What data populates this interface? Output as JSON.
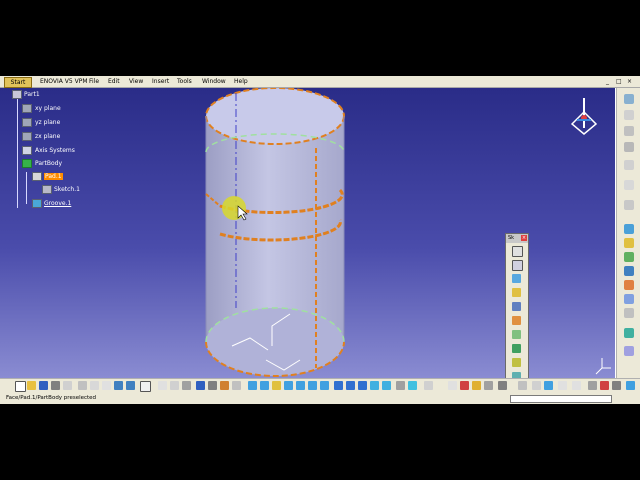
{
  "menu": {
    "start": "Start",
    "enovia": "ENOVIA V5 VPM",
    "file": "File",
    "edit": "Edit",
    "view": "View",
    "insert": "Insert",
    "tools": "Tools",
    "window": "Window",
    "help": "Help"
  },
  "tree": {
    "root": "Part1",
    "xy": "xy plane",
    "yz": "yz plane",
    "zx": "zx plane",
    "axis": "Axis Systems",
    "body": "PartBody",
    "pad": "Pad.1",
    "sketch": "Sketch.1",
    "groove": "Groove.1"
  },
  "sketch_toolbar": {
    "title": "Sk"
  },
  "status": {
    "text": "Face/Pad.1/PartBody preselected"
  },
  "colors": {
    "viewport_top": "#2a2c88",
    "viewport_bottom": "#8a8cd2",
    "selection": "#ff8c00",
    "highlight_edge": "#e08020"
  }
}
